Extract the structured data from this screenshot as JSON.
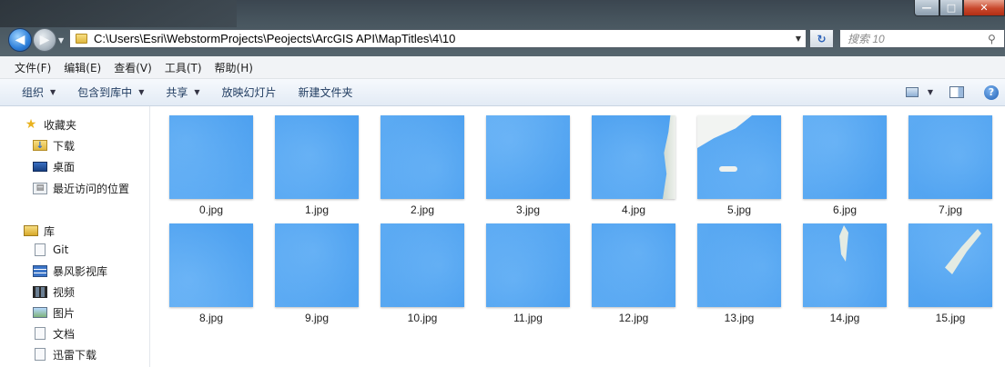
{
  "window": {
    "buttons": {
      "minimize": "—",
      "maximize": "□",
      "close": "✕"
    }
  },
  "addressbar": {
    "path": "C:\\Users\\Esri\\WebstormProjects\\Peojects\\ArcGIS API\\MapTitles\\4\\10",
    "search_placeholder": "搜索 10"
  },
  "menubar": [
    {
      "label": "文件(F)"
    },
    {
      "label": "编辑(E)"
    },
    {
      "label": "查看(V)"
    },
    {
      "label": "工具(T)"
    },
    {
      "label": "帮助(H)"
    }
  ],
  "toolbar": [
    {
      "label": "组织",
      "dropdown": true
    },
    {
      "label": "包含到库中",
      "dropdown": true
    },
    {
      "label": "共享",
      "dropdown": true
    },
    {
      "label": "放映幻灯片",
      "dropdown": false
    },
    {
      "label": "新建文件夹",
      "dropdown": false
    }
  ],
  "navpane": {
    "favorites": {
      "label": "收藏夹",
      "items": [
        {
          "label": "下载",
          "icon": "download-folder-icon"
        },
        {
          "label": "桌面",
          "icon": "desktop-icon"
        },
        {
          "label": "最近访问的位置",
          "icon": "recent-places-icon"
        }
      ]
    },
    "libraries": {
      "label": "库",
      "items": [
        {
          "label": "Git",
          "icon": "git-library-icon"
        },
        {
          "label": "暴风影视库",
          "icon": "video-library-icon"
        },
        {
          "label": "视频",
          "icon": "videos-icon"
        },
        {
          "label": "图片",
          "icon": "pictures-icon"
        },
        {
          "label": "文档",
          "icon": "documents-icon"
        },
        {
          "label": "迅雷下载",
          "icon": "xunlei-download-icon"
        }
      ]
    }
  },
  "files": [
    {
      "name": "0.jpg"
    },
    {
      "name": "1.jpg"
    },
    {
      "name": "2.jpg"
    },
    {
      "name": "3.jpg"
    },
    {
      "name": "4.jpg"
    },
    {
      "name": "5.jpg"
    },
    {
      "name": "6.jpg"
    },
    {
      "name": "7.jpg"
    },
    {
      "name": "8.jpg"
    },
    {
      "name": "9.jpg"
    },
    {
      "name": "10.jpg"
    },
    {
      "name": "11.jpg"
    },
    {
      "name": "12.jpg"
    },
    {
      "name": "13.jpg"
    },
    {
      "name": "14.jpg"
    },
    {
      "name": "15.jpg"
    }
  ],
  "colors": {
    "ocean_light": "#a9d8fb",
    "ocean": "#8ccaf7",
    "land": "#e8ece8",
    "accent": "#2e7fd9"
  }
}
